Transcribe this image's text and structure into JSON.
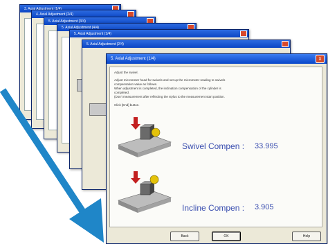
{
  "app": {
    "window_title": "5. Axial Adjustment (1/4)",
    "close_glyph": "x"
  },
  "stack_titles": [
    "3. Axial Adjustment (1/4)",
    "4. Axial Adjustment (2/4)",
    "5. Axial Adjustment (3/4)",
    "5. Axial Adjustment (4/4)",
    "5. Axial Adjustment (1/4)",
    "5. Axial Adjustment (2/4)"
  ],
  "instructions": {
    "line1": "Adjust the swivel.",
    "line2": "Adjust micrometer head for swivels and set up the micrometer reading to swivels",
    "line3": "compensation value as follows.",
    "line4": "When adjustment is completed, the inclination compensation of the cylinder is",
    "line5": "completed.",
    "line6": "(Don't measurement after reflecting the stylus to the measurement start position.",
    "line7": "Click [End] button."
  },
  "readouts": {
    "swivel_label": "Swivel Compen :",
    "swivel_value": "33.995",
    "incline_label": "Incline Compen :",
    "incline_value": "3.905"
  },
  "buttons": {
    "back": "Back",
    "ok": "OK",
    "help": "Help"
  },
  "colors": {
    "accent_arrow": "#1f86c8",
    "titlebar": "#0a47c9",
    "readout_text": "#3b4fb0"
  }
}
